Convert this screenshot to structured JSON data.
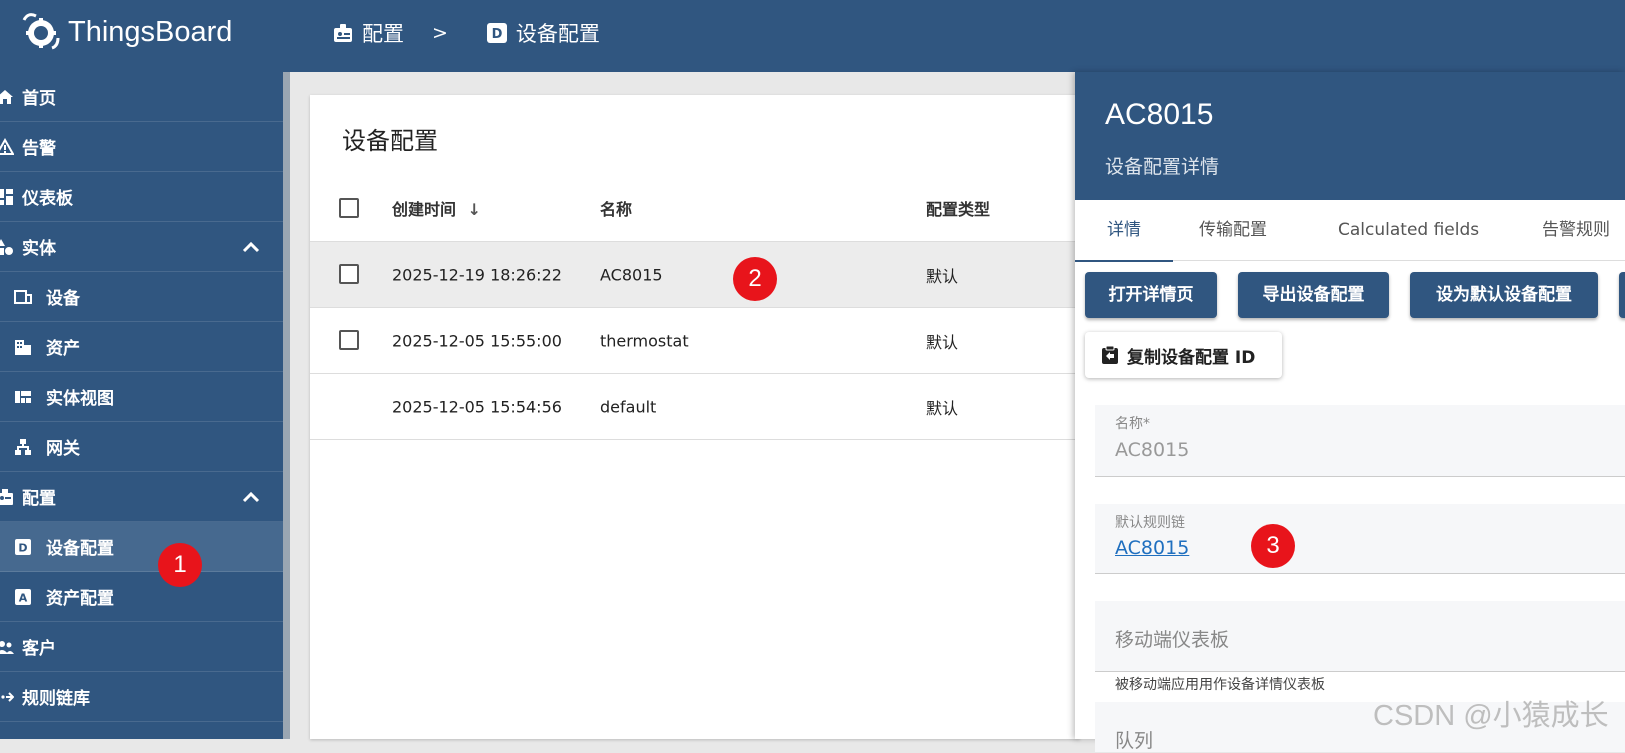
{
  "app": {
    "name": "ThingsBoard"
  },
  "breadcrumb": [
    {
      "label": "配置",
      "icon": "settings-badge-icon"
    },
    {
      "separator": ">"
    },
    {
      "label": "设备配置",
      "icon": "device-profile-icon"
    }
  ],
  "sidebar": {
    "items": [
      {
        "label": "首页",
        "icon": "home-icon"
      },
      {
        "label": "告警",
        "icon": "alarm-warning-icon"
      },
      {
        "label": "仪表板",
        "icon": "dashboard-icon"
      },
      {
        "label": "实体",
        "icon": "entities-icon",
        "expanded": true
      },
      {
        "label": "设备",
        "icon": "devices-icon"
      },
      {
        "label": "资产",
        "icon": "building-icon"
      },
      {
        "label": "实体视图",
        "icon": "view-quilt-icon"
      },
      {
        "label": "网关",
        "icon": "gateway-icon"
      },
      {
        "label": "配置",
        "icon": "settings-badge-icon",
        "expanded": true
      },
      {
        "label": "设备配置",
        "icon": "device-profile-icon",
        "active": true
      },
      {
        "label": "资产配置",
        "icon": "asset-profile-icon"
      },
      {
        "label": "客户",
        "icon": "customers-icon"
      },
      {
        "label": "规则链库",
        "icon": "rule-chain-icon"
      }
    ]
  },
  "main": {
    "title": "设备配置",
    "table": {
      "columns": [
        "创建时间",
        "名称",
        "配置类型"
      ],
      "sort_indicator": "↓",
      "rows": [
        {
          "created": "2025-12-19 18:26:22",
          "name": "AC8015",
          "type": "默认",
          "selected": true
        },
        {
          "created": "2025-12-05 15:55:00",
          "name": "thermostat",
          "type": "默认"
        },
        {
          "created": "2025-12-05 15:54:56",
          "name": "default",
          "type": "默认"
        }
      ]
    }
  },
  "details": {
    "title": "AC8015",
    "subtitle": "设备配置详情",
    "tabs": [
      "详情",
      "传输配置",
      "Calculated fields",
      "告警规则"
    ],
    "buttons": [
      "打开详情页",
      "导出设备配置",
      "设为默认设备配置"
    ],
    "copy_button": "复制设备配置 ID",
    "fields": {
      "name_label": "名称*",
      "name_value": "AC8015",
      "rule_chain_label": "默认规则链",
      "rule_chain_value": "AC8015",
      "mobile_dashboard_placeholder": "移动端仪表板",
      "mobile_dashboard_hint": "被移动端应用用作设备详情仪表板",
      "queue_label": "队列"
    }
  },
  "annotations": [
    "1",
    "2",
    "3"
  ],
  "watermark": "CSDN @小猿成长",
  "colors": {
    "primary": "#305680",
    "badge": "#e8141b",
    "link": "#1f6fbf"
  }
}
